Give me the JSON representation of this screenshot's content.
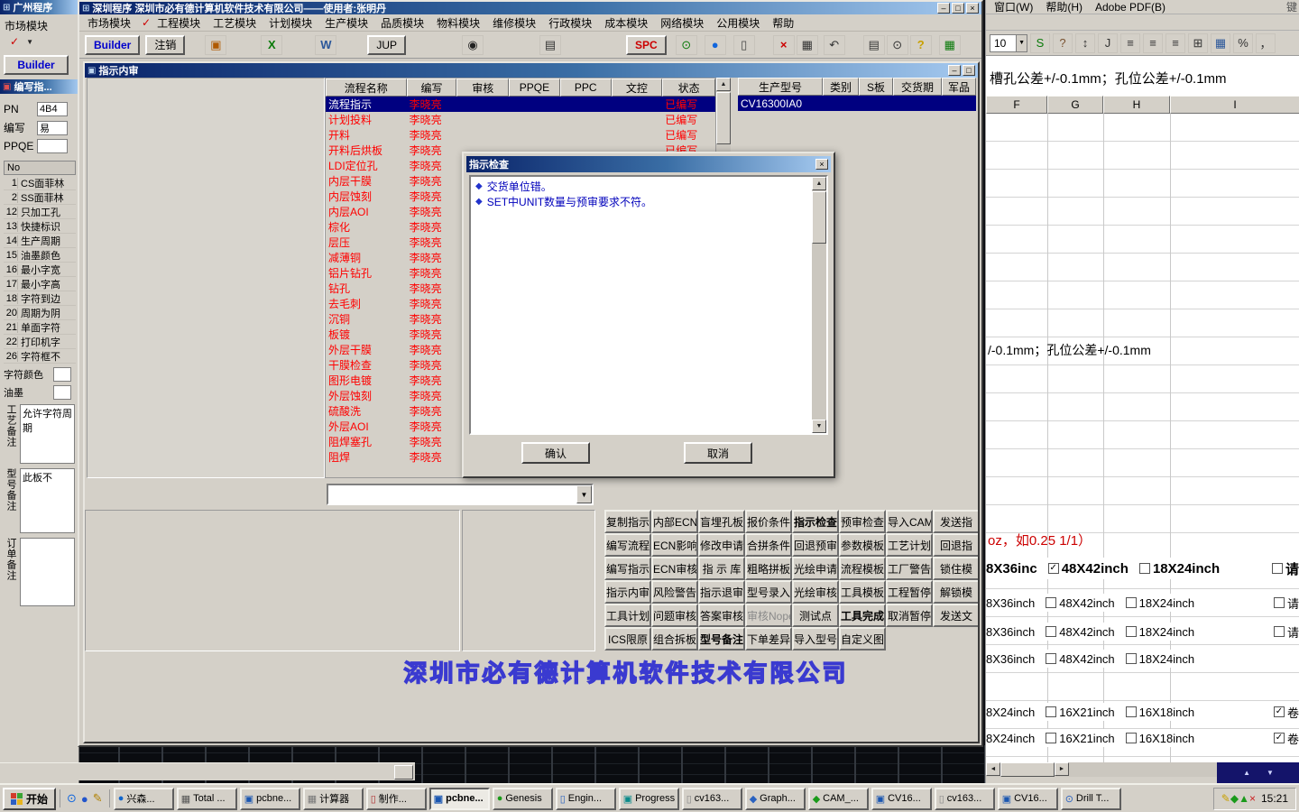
{
  "colors": {
    "window_face": "#d4d0c8",
    "titlebar_dark": "#0a246a",
    "titlebar_light": "#a6caf0",
    "selection_navy": "#000080",
    "flow_text_red": "#ff0000",
    "dialog_text_blue": "#0000bb",
    "watermark_blue": "#3a3ad0"
  },
  "left_window": {
    "title": "广州程序",
    "menu_label": "市场模块",
    "builder_tab": "Builder",
    "inner_title": "编写指...",
    "fields": [
      {
        "label": "PN",
        "value": "4B4"
      },
      {
        "label": "编写",
        "value": "易"
      },
      {
        "label": "PPQE",
        "value": ""
      }
    ],
    "list_header": "No",
    "list_items": [
      {
        "no": "1",
        "text": "CS面菲林"
      },
      {
        "no": "2",
        "text": "SS面菲林"
      },
      {
        "no": "12",
        "text": "只加工孔"
      },
      {
        "no": "13",
        "text": "快捷标识"
      },
      {
        "no": "14",
        "text": "生产周期"
      },
      {
        "no": "15",
        "text": "油墨颜色"
      },
      {
        "no": "16",
        "text": "最小字宽"
      },
      {
        "no": "17",
        "text": "最小字高"
      },
      {
        "no": "18",
        "text": "字符到边"
      },
      {
        "no": "20",
        "text": "周期为阴"
      },
      {
        "no": "21",
        "text": "单面字符"
      },
      {
        "no": "22",
        "text": "打印机字"
      },
      {
        "no": "26",
        "text": "字符框不"
      }
    ],
    "char_color_label": "字符颜色",
    "ink_label": "油墨",
    "note_labels": [
      "工艺备注",
      "型号备注",
      "订单备注"
    ],
    "craft_note": "允许字符周期",
    "model_note": "此板不"
  },
  "main_window": {
    "title": "深圳程序   深圳市必有德计算机软件技术有限公司——使用者:张明丹",
    "menu": [
      "市场模块",
      "工程模块",
      "工艺模块",
      "计划模块",
      "生产模块",
      "品质模块",
      "物料模块",
      "维修模块",
      "行政模块",
      "成本模块",
      "网络模块",
      "公用模块",
      "帮助"
    ],
    "toolbar": [
      {
        "name": "builder-button",
        "label": "Builder",
        "wide": true,
        "color": "#0000cc",
        "bold": true
      },
      {
        "name": "logout-button",
        "label": "注销",
        "wide": true
      },
      {
        "name": "frame-icon",
        "label": "▣",
        "color": "#b05a00"
      },
      {
        "name": "excel-icon",
        "label": "X",
        "color": "#0a7a0a",
        "bold": true
      },
      {
        "name": "word-icon",
        "label": "W",
        "color": "#2b579a",
        "bold": true
      },
      {
        "name": "jup-button",
        "label": "JUP",
        "wide": true
      },
      {
        "name": "camera-icon",
        "label": "◉",
        "color": "#222222"
      },
      {
        "name": "printer-icon",
        "label": "▤",
        "color": "#333333"
      },
      {
        "name": "spc-button",
        "label": "SPC",
        "wide": true,
        "color": "#cc0000",
        "bold": true
      },
      {
        "name": "refresh-icon",
        "label": "⊙",
        "color": "#0a7a0a"
      },
      {
        "name": "globe-icon",
        "label": "●",
        "color": "#1166dd"
      },
      {
        "name": "document-icon",
        "label": "▯",
        "color": "#444444"
      },
      {
        "name": "delete-icon",
        "label": "×",
        "color": "#cc0000",
        "bold": true
      },
      {
        "name": "save-icon",
        "label": "▦",
        "color": "#333333"
      },
      {
        "name": "undo-icon",
        "label": "↶",
        "color": "#333333"
      },
      {
        "name": "print-icon",
        "label": "▤",
        "color": "#333333"
      },
      {
        "name": "search-icon",
        "label": "⊙",
        "color": "#333333"
      },
      {
        "name": "help-icon",
        "label": "?",
        "color": "#c8a000",
        "bold": true
      },
      {
        "name": "grid-icon",
        "label": "▦",
        "color": "#0a7a0a"
      }
    ]
  },
  "inner_window": {
    "title": "指示内审",
    "flow_table": {
      "columns": [
        "流程名称",
        "编写",
        "审核",
        "PPQE",
        "PPC",
        "文控",
        "状态"
      ],
      "rows": [
        {
          "name": "流程指示",
          "writer": "李晓亮",
          "status": "已编写",
          "selected": true
        },
        {
          "name": "计划投料",
          "writer": "李晓亮",
          "status": "已编写"
        },
        {
          "name": "开料",
          "writer": "李晓亮",
          "status": "已编写"
        },
        {
          "name": "开料后烘板",
          "writer": "李晓亮",
          "status": "已编写"
        },
        {
          "name": "LDI定位孔",
          "writer": "李晓亮"
        },
        {
          "name": "内层干膜",
          "writer": "李晓亮"
        },
        {
          "name": "内层蚀刻",
          "writer": "李晓亮"
        },
        {
          "name": "内层AOI",
          "writer": "李晓亮"
        },
        {
          "name": "棕化",
          "writer": "李晓亮"
        },
        {
          "name": "层压",
          "writer": "李晓亮"
        },
        {
          "name": "减薄铜",
          "writer": "李晓亮"
        },
        {
          "name": "铝片钻孔",
          "writer": "李晓亮"
        },
        {
          "name": "钻孔",
          "writer": "李晓亮"
        },
        {
          "name": "去毛刺",
          "writer": "李晓亮"
        },
        {
          "name": "沉铜",
          "writer": "李晓亮"
        },
        {
          "name": "板镀",
          "writer": "李晓亮"
        },
        {
          "name": "外层干膜",
          "writer": "李晓亮"
        },
        {
          "name": "干膜检查",
          "writer": "李晓亮"
        },
        {
          "name": "图形电镀",
          "writer": "李晓亮"
        },
        {
          "name": "外层蚀刻",
          "writer": "李晓亮"
        },
        {
          "name": "硫酸洗",
          "writer": "李晓亮"
        },
        {
          "name": "外层AOI",
          "writer": "李晓亮"
        },
        {
          "name": "阻焊塞孔",
          "writer": "李晓亮"
        },
        {
          "name": "阻焊",
          "writer": "李晓亮"
        }
      ]
    },
    "model_table": {
      "columns": [
        "生产型号",
        "类别",
        "S板",
        "交货期",
        "军品"
      ],
      "rows": [
        {
          "model": "CV16300IA0",
          "selected": true
        }
      ]
    },
    "combo_value": "",
    "button_grid": [
      [
        "复制指示",
        "内部ECN",
        "盲埋孔板",
        "报价条件",
        "指示检查",
        "预审检查",
        "导入CAM",
        "发送指"
      ],
      [
        "编写流程",
        "ECN影响",
        "修改申请",
        "合拼条件",
        "回退预审",
        "参数模板",
        "工艺计划",
        "回退指"
      ],
      [
        "编写指示",
        "ECN审核",
        "指 示 库",
        "粗略拼板",
        "光绘申请",
        "流程模板",
        "工厂警告",
        "锁住模"
      ],
      [
        "指示内审",
        "风险警告",
        "指示退审",
        "型号录入",
        "光绘审核",
        "工具模板",
        "工程暂停",
        "解锁模"
      ],
      [
        "工具计划",
        "问题审核",
        "答案审核",
        "审核Nope",
        "测试点",
        "工具完成",
        "取消暂停",
        "发送文"
      ],
      [
        "ICS限原",
        "组合拆板",
        "型号备注",
        "下单差异",
        "导入型号",
        "自定义图",
        "",
        ""
      ]
    ],
    "bold_buttons": [
      "指示检查",
      "工具完成",
      "型号备注"
    ],
    "disabled_buttons": [
      "审核Nope"
    ],
    "watermark": "深圳市必有德计算机软件技术有限公司"
  },
  "dialog": {
    "title": "指示检查",
    "items": [
      "交货单位错。",
      "SET中UNIT数量与预审要求不符。"
    ],
    "ok": "确认",
    "cancel": "取消"
  },
  "right_window": {
    "menu": [
      "窗口(W)",
      "帮助(H)",
      "Adobe PDF(B)"
    ],
    "menu_right": "键",
    "font_size": "10",
    "toolbar_icons": [
      {
        "name": "bold-s-icon",
        "label": "S",
        "color": "#0a7a0a"
      },
      {
        "name": "help-icon",
        "label": "?",
        "color": "#7a5230"
      },
      {
        "name": "spinner-icon",
        "label": "↕",
        "color": "#333333"
      },
      {
        "name": "j-icon",
        "label": "J",
        "color": "#333333"
      },
      {
        "name": "align-left-icon",
        "label": "≡",
        "color": "#333333"
      },
      {
        "name": "align-center-icon",
        "label": "≡",
        "color": "#333333"
      },
      {
        "name": "align-right-icon",
        "label": "≡",
        "color": "#333333"
      },
      {
        "name": "merge-cells-icon",
        "label": "⊞",
        "color": "#333333"
      },
      {
        "name": "grid-icon",
        "label": "▦",
        "color": "#2b579a"
      },
      {
        "name": "percent-icon",
        "label": "%",
        "color": "#333333"
      },
      {
        "name": "comma-icon",
        "label": "，",
        "color": "#333333"
      }
    ],
    "cell_text_top": "槽孔公差+/-0.1mm；孔位公差+/-0.1mm",
    "columns": [
      "F",
      "G",
      "H",
      "I"
    ],
    "cell_text_mid": "/-0.1mm；孔位公差+/-0.1mm",
    "red_text": "oz，如0.25 1/1）",
    "checkbox_rows": [
      {
        "label": "8X36inc",
        "large": true,
        "options": [
          {
            "text": "48X42inch",
            "checked": true
          },
          {
            "text": "18X24inch",
            "checked": false
          }
        ],
        "tail": {
          "text": "请",
          "checked": false
        }
      },
      {
        "label": "8X36inch",
        "large": false,
        "options": [
          {
            "text": "48X42inch",
            "checked": false
          },
          {
            "text": "18X24inch",
            "checked": false
          }
        ],
        "tail": {
          "text": "请",
          "checked": false
        }
      },
      {
        "label": "8X36inch",
        "large": false,
        "options": [
          {
            "text": "48X42inch",
            "checked": false
          },
          {
            "text": "18X24inch",
            "checked": false
          }
        ],
        "tail": {
          "text": "请",
          "checked": false
        }
      },
      {
        "label": "8X36inch",
        "large": false,
        "options": [
          {
            "text": "48X42inch",
            "checked": false
          },
          {
            "text": "18X24inch",
            "checked": false
          }
        ],
        "tail": null
      },
      {
        "label": "8X24inch",
        "large": false,
        "options": [
          {
            "text": "16X21inch",
            "checked": false
          },
          {
            "text": "16X18inch",
            "checked": false
          }
        ],
        "tail": {
          "text": "卷",
          "checked": true
        }
      },
      {
        "label": "8X24inch",
        "large": false,
        "options": [
          {
            "text": "16X21inch",
            "checked": false
          },
          {
            "text": "16X18inch",
            "checked": false
          }
        ],
        "tail": {
          "text": "卷",
          "checked": true
        }
      }
    ]
  },
  "taskbar": {
    "start_label": "开始",
    "clock": "15:21",
    "quick_launch": [
      {
        "name": "quick-launch-desktop-icon",
        "glyph": "⊙",
        "color": "#1166dd"
      },
      {
        "name": "quick-launch-browser-icon",
        "glyph": "●",
        "color": "#2255cc"
      },
      {
        "name": "quick-launch-editor-icon",
        "glyph": "✎",
        "color": "#b08000"
      }
    ],
    "tasks": [
      {
        "label": "兴森...",
        "glyph": "●",
        "color": "#1166cc",
        "active": false
      },
      {
        "label": "Total ...",
        "glyph": "▦",
        "color": "#555555",
        "active": false
      },
      {
        "label": "pcbne...",
        "glyph": "▣",
        "color": "#1a56b0",
        "active": false
      },
      {
        "label": "计算器",
        "glyph": "▦",
        "color": "#777777",
        "active": false
      },
      {
        "label": "制作...",
        "glyph": "▯",
        "color": "#b03030",
        "active": false
      },
      {
        "label": "pcbne...",
        "glyph": "▣",
        "color": "#1a56b0",
        "active": true
      },
      {
        "label": "Genesis",
        "glyph": "●",
        "color": "#1a9a1a",
        "active": false
      },
      {
        "label": "Engin...",
        "glyph": "▯",
        "color": "#2a62c0",
        "active": false
      },
      {
        "label": "Progress",
        "glyph": "▣",
        "color": "#0a8a8a",
        "active": false
      },
      {
        "label": "cv163...",
        "glyph": "▯",
        "color": "#888888",
        "active": false
      },
      {
        "label": "Graph...",
        "glyph": "◆",
        "color": "#2a62c0",
        "active": false
      },
      {
        "label": "CAM_...",
        "glyph": "◆",
        "color": "#1a9a1a",
        "active": false
      },
      {
        "label": "CV16...",
        "glyph": "▣",
        "color": "#1a56b0",
        "active": false
      },
      {
        "label": "cv163...",
        "glyph": "▯",
        "color": "#888888",
        "active": false
      },
      {
        "label": "CV16...",
        "glyph": "▣",
        "color": "#1a56b0",
        "active": false
      },
      {
        "label": "Drill T...",
        "glyph": "⊙",
        "color": "#2a62c0",
        "active": false
      }
    ],
    "tray_icons": [
      {
        "name": "tray-pencil-icon",
        "glyph": "✎",
        "color": "#c8a000"
      },
      {
        "name": "tray-green-diamond-icon",
        "glyph": "◆",
        "color": "#1a9a1a"
      },
      {
        "name": "tray-green-arrow-icon",
        "glyph": "▲",
        "color": "#1a9a1a"
      },
      {
        "name": "tray-close-icon",
        "glyph": "×",
        "color": "#cc2222"
      }
    ]
  }
}
